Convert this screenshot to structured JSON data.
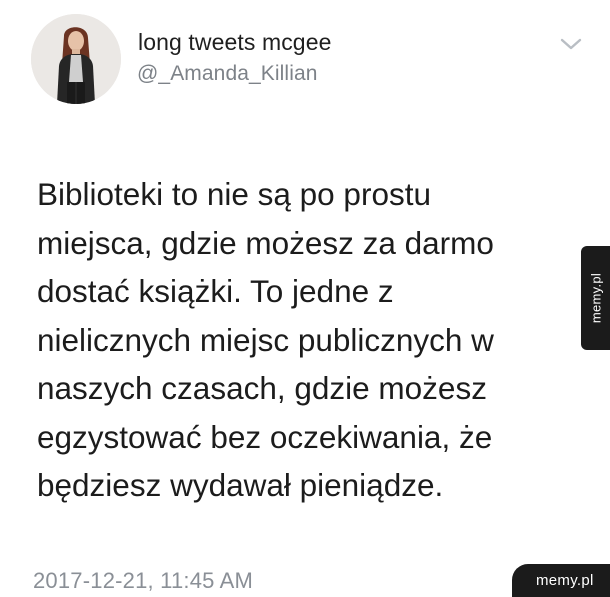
{
  "tweet": {
    "display_name": "long tweets mcgee",
    "handle": "@_Amanda_Killian",
    "text": "Biblioteki to nie są po prostu\nmiejsca, gdzie możesz za darmo\ndostać książki. To jedne z\nnielicznych miejsc publicznych w\nnaszych czasach, gdzie możesz\negzystować bez oczekiwania, że\nbędziesz wydawał pieniądze.",
    "timestamp": "2017-12-21, 11:45 AM",
    "avatar_icon": "profile-photo",
    "menu_icon": "chevron-down-icon"
  },
  "watermark": {
    "side_text": "memy.pl",
    "corner_text": "memy.pl"
  },
  "colors": {
    "text": "#1c1c1c",
    "muted": "#7d8288",
    "watermark_bg": "#1b1b1b"
  }
}
